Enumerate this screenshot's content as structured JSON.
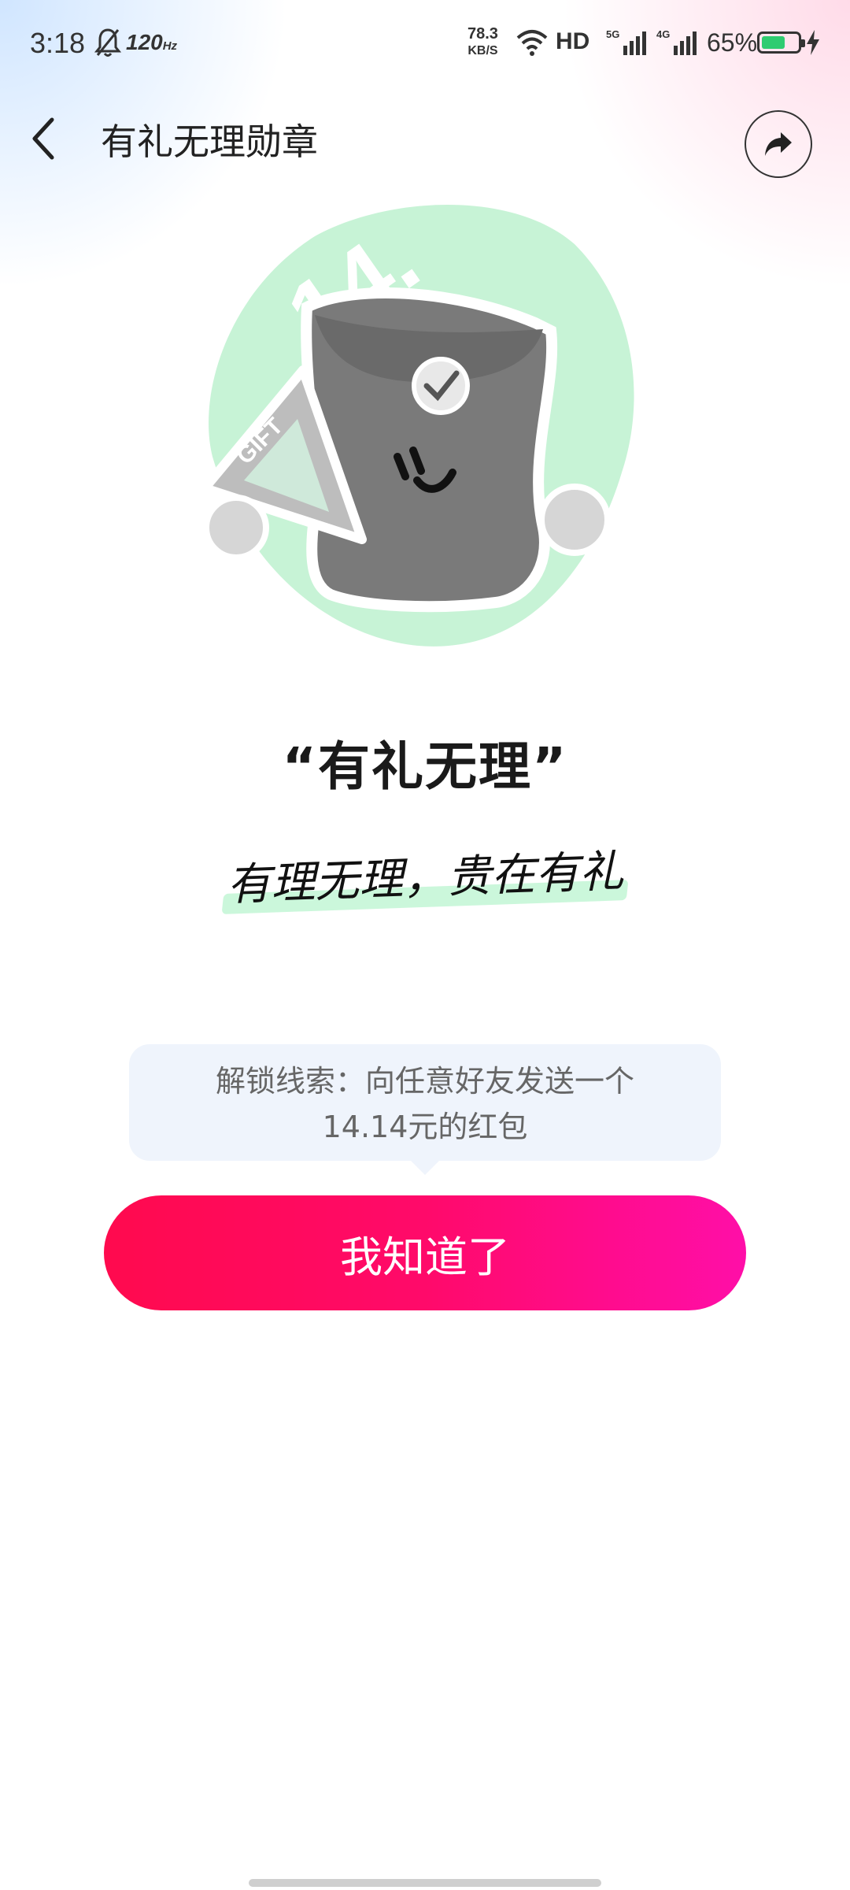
{
  "status_bar": {
    "time": "3:18",
    "refresh_rate": "120",
    "refresh_unit": "Hz",
    "net_speed_value": "78.3",
    "net_speed_unit": "KB/S",
    "hd_label": "HD",
    "signal_1_label": "5G",
    "signal_2_label": "4G",
    "battery_percent": "65%",
    "battery_level": 0.65,
    "battery_color": "#2ecc71"
  },
  "header": {
    "title": "有礼无理勋章"
  },
  "badge": {
    "image_text": "GIFT",
    "number_text": "14.",
    "name": "“有礼无理”",
    "motto": "有理无理，贵在有礼"
  },
  "hint": {
    "line1": "解锁线索：向任意好友发送一个",
    "line2": "14.14元的红包"
  },
  "actions": {
    "ok_label": "我知道了"
  },
  "colors": {
    "button_start": "#ff0a4e",
    "button_end": "#ff0ea8",
    "tooltip_bg": "#eff4fc",
    "badge_accent": "#b9f3cf"
  }
}
